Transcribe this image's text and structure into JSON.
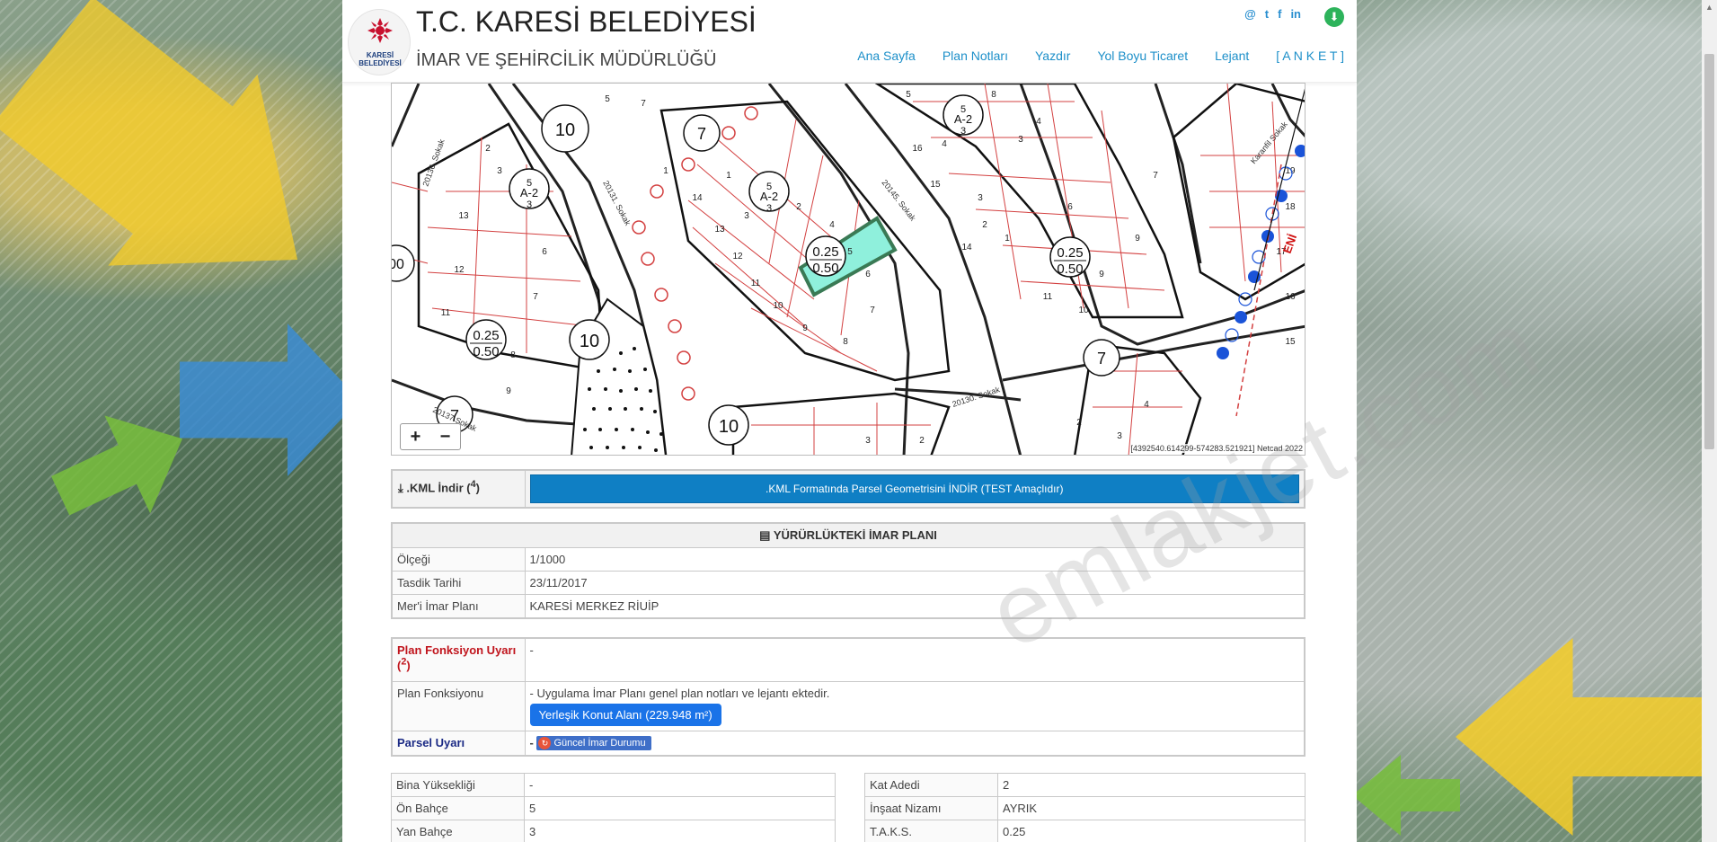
{
  "header": {
    "title": "T.C. KARESİ BELEDİYESİ",
    "subtitle": "İMAR VE ŞEHİRCİLİK MÜDÜRLÜĞÜ",
    "logo_text": "KARESİ BELEDİYESİ",
    "social": [
      "@",
      "t",
      "f",
      "in"
    ],
    "nav": [
      "Ana Sayfa",
      "Plan Notları",
      "Yazdır",
      "Yol Boyu Ticaret",
      "Lejant",
      "[ A N K E T ]"
    ]
  },
  "map": {
    "zoom_in": "+",
    "zoom_out": "−",
    "coords": "[4392540.614299-574283.521921] Netcad 2022",
    "labels": {
      "l_10a": "10",
      "l_7a": "7",
      "l_a2_top": "5\nA-2\n3",
      "l_025": "0.25",
      "l_050": "0.50",
      "street1": "20136. Sokak",
      "street2": "20131. Sokak",
      "street3": "20145. Sokak",
      "street4": "20130. Sokak",
      "street5": "Karanfil Sokak"
    }
  },
  "watermark": "emlakjet.com",
  "kml": {
    "label": ".KML İndir",
    "sup": "4",
    "button": ".KML Formatında Parsel Geometrisini İNDİR (TEST Amaçlıdır)"
  },
  "plan": {
    "heading": "YÜRÜRLÜKTEKİ İMAR PLANI",
    "rows": [
      {
        "label": "Ölçeği",
        "value": "1/1000"
      },
      {
        "label": "Tasdik Tarihi",
        "value": "23/11/2017"
      },
      {
        "label": "Mer'i İmar Planı",
        "value": "KARESİ MERKEZ RİUİP"
      }
    ]
  },
  "func": {
    "warn_label": "Plan Fonksiyon Uyarı",
    "warn_sup": "2",
    "warn_value": "-",
    "func_label": "Plan Fonksiyonu",
    "func_text": "- Uygulama İmar Planı genel plan notları ve lejantı ektedir.",
    "func_badge": "Yerleşik Konut Alanı (229.948 m²)",
    "parsel_label": "Parsel Uyarı",
    "parsel_dash": "-",
    "parsel_badge": "Güncel İmar Durumu"
  },
  "left_table": [
    {
      "label": "Bina Yüksekliği",
      "value": "-"
    },
    {
      "label": "Ön Bahçe",
      "value": "5"
    },
    {
      "label": "Yan Bahçe",
      "value": "3"
    }
  ],
  "right_table": [
    {
      "label": "Kat Adedi",
      "value": "2"
    },
    {
      "label": "İnşaat Nizamı",
      "value": "AYRIK"
    },
    {
      "label": "T.A.K.S.",
      "value": "0.25"
    }
  ]
}
